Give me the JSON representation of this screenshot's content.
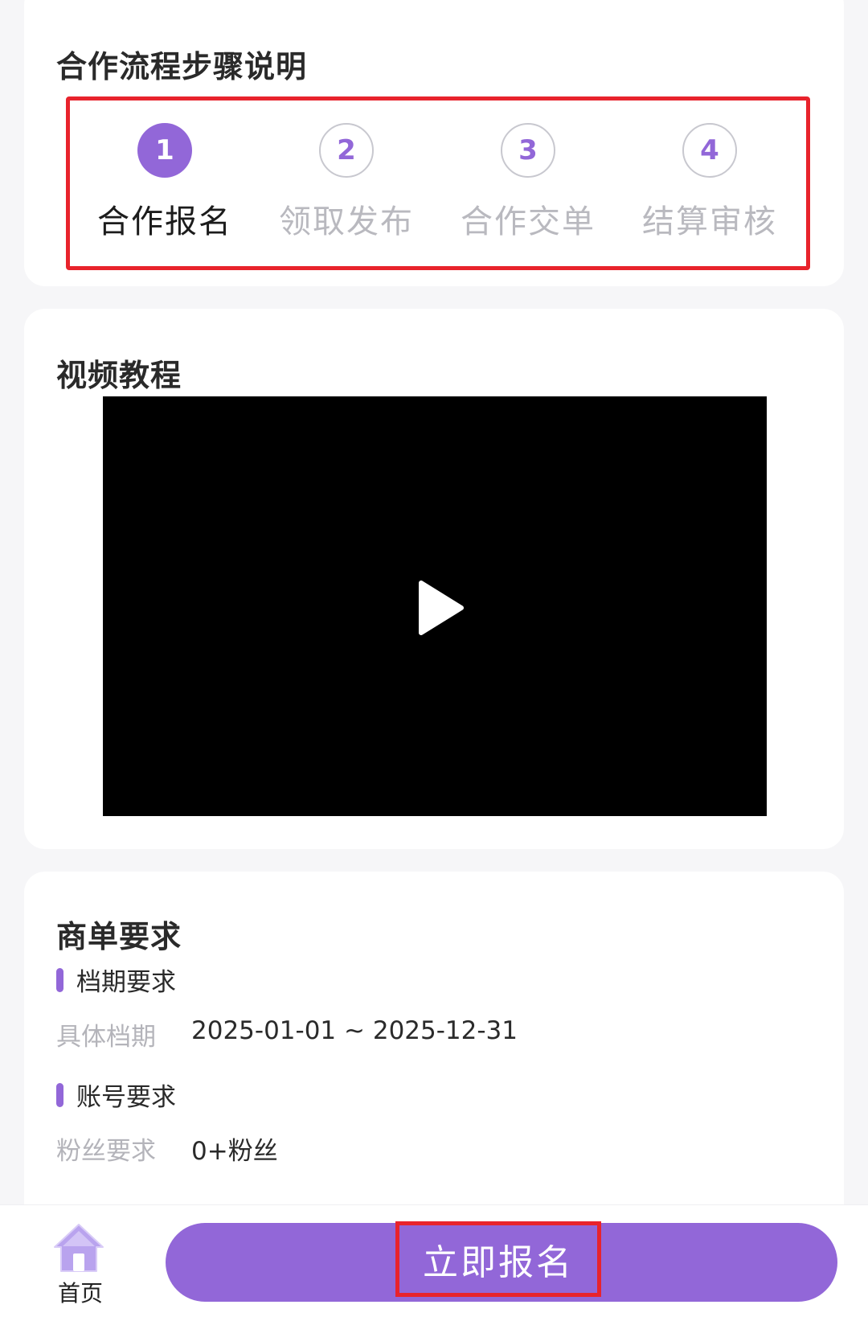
{
  "steps_card": {
    "title": "合作流程步骤说明",
    "steps": [
      {
        "number": "1",
        "label": "合作报名",
        "active": true
      },
      {
        "number": "2",
        "label": "领取发布",
        "active": false
      },
      {
        "number": "3",
        "label": "合作交单",
        "active": false
      },
      {
        "number": "4",
        "label": "结算审核",
        "active": false
      }
    ]
  },
  "video_card": {
    "title": "视频教程",
    "play_icon": "play-icon"
  },
  "requirements_card": {
    "title": "商单要求",
    "schedule": {
      "heading": "档期要求",
      "label": "具体档期",
      "value": "2025-01-01 ~ 2025-12-31"
    },
    "account": {
      "heading": "账号要求",
      "label": "粉丝要求",
      "value": "0+粉丝"
    }
  },
  "bottom_bar": {
    "home_label": "首页",
    "home_icon": "home-icon",
    "signup_label": "立即报名"
  },
  "colors": {
    "accent": "#9267d8",
    "highlight_red": "#e8232c"
  }
}
